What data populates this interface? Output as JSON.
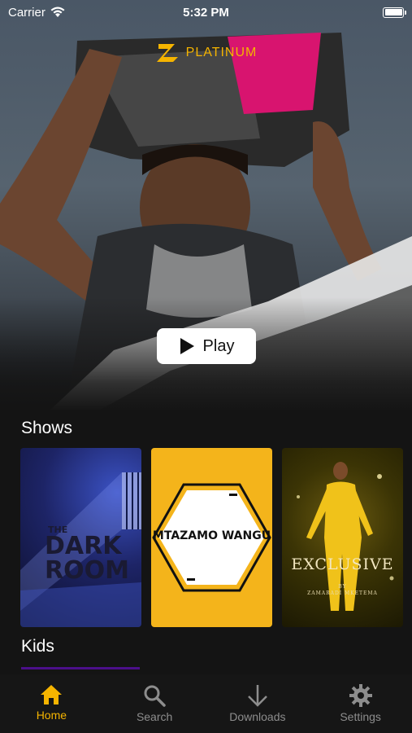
{
  "status_bar": {
    "carrier": "Carrier",
    "time": "5:32 PM",
    "battery_level": 1.0
  },
  "brand": {
    "name": "PLATINUM",
    "color": "#f5b400"
  },
  "hero": {
    "play_label": "Play"
  },
  "shows": {
    "title": "Shows",
    "items": [
      {
        "the": "THE",
        "line1": "DARK",
        "line2": "ROOM"
      },
      {
        "title": "MTAZAMO WANGU"
      },
      {
        "title": "EXCLUSIVE",
        "subtitle_by": "BY",
        "subtitle": "ZAMARADI MKETEMA"
      }
    ]
  },
  "kids": {
    "title": "Kids"
  },
  "tabs": [
    {
      "label": "Home",
      "icon": "home-icon",
      "active": true
    },
    {
      "label": "Search",
      "icon": "search-icon",
      "active": false
    },
    {
      "label": "Downloads",
      "icon": "download-icon",
      "active": false
    },
    {
      "label": "Settings",
      "icon": "gear-icon",
      "active": false
    }
  ],
  "colors": {
    "accent": "#f5b400",
    "tab_inactive": "#8d8d8d",
    "background": "#141414"
  }
}
